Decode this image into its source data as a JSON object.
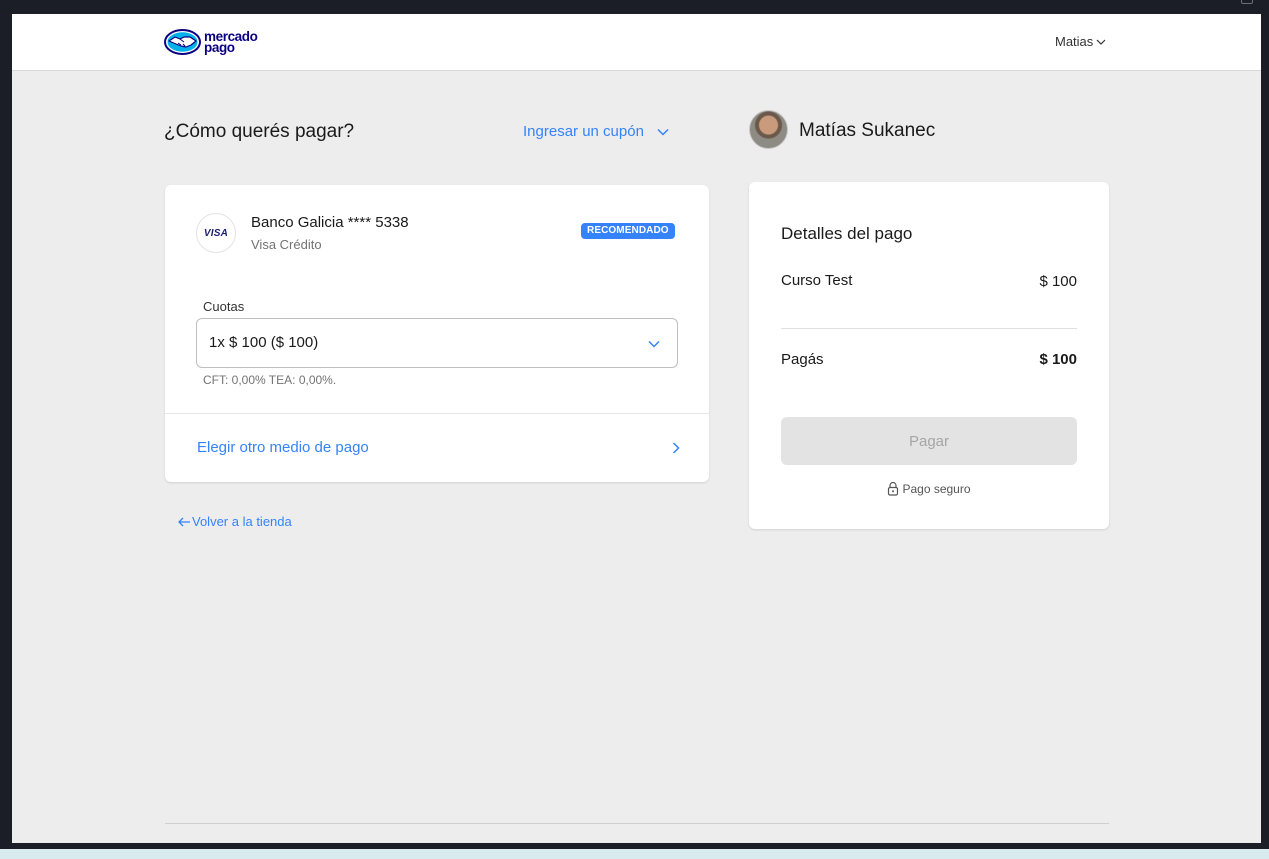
{
  "header": {
    "logo_line1": "mercado",
    "logo_line2": "pago",
    "user_menu_label": "Matias"
  },
  "payment": {
    "title": "¿Cómo querés pagar?",
    "coupon_label": "Ingresar un cupón",
    "card": {
      "brand_mark": "VISA",
      "bank_name": "Banco Galicia **** 5338",
      "card_type": "Visa Crédito",
      "badge": "RECOMENDADO"
    },
    "installments": {
      "label": "Cuotas",
      "selected": "1x $ 100 ($ 100)",
      "note": "CFT: 0,00% TEA: 0,00%."
    },
    "other_method_label": "Elegir otro medio de pago",
    "back_label": "Volver a la tienda"
  },
  "summary": {
    "user_name": "Matías Sukanec",
    "title": "Detalles del pago",
    "item_name": "Curso Test",
    "item_price": "$ 100",
    "total_label": "Pagás",
    "total_value": "$ 100",
    "pay_button": "Pagar",
    "secure_label": "Pago seguro"
  },
  "colors": {
    "accent": "#3483fa",
    "brand": "#0a0080",
    "background": "#ededed"
  },
  "icons": {
    "logo": "handshake-logo-icon",
    "user_menu": "chevron-down-icon",
    "coupon": "chevron-down-icon",
    "installments": "chevron-down-icon",
    "other_method": "chevron-right-icon",
    "back": "arrow-left-icon",
    "secure": "lock-icon"
  }
}
